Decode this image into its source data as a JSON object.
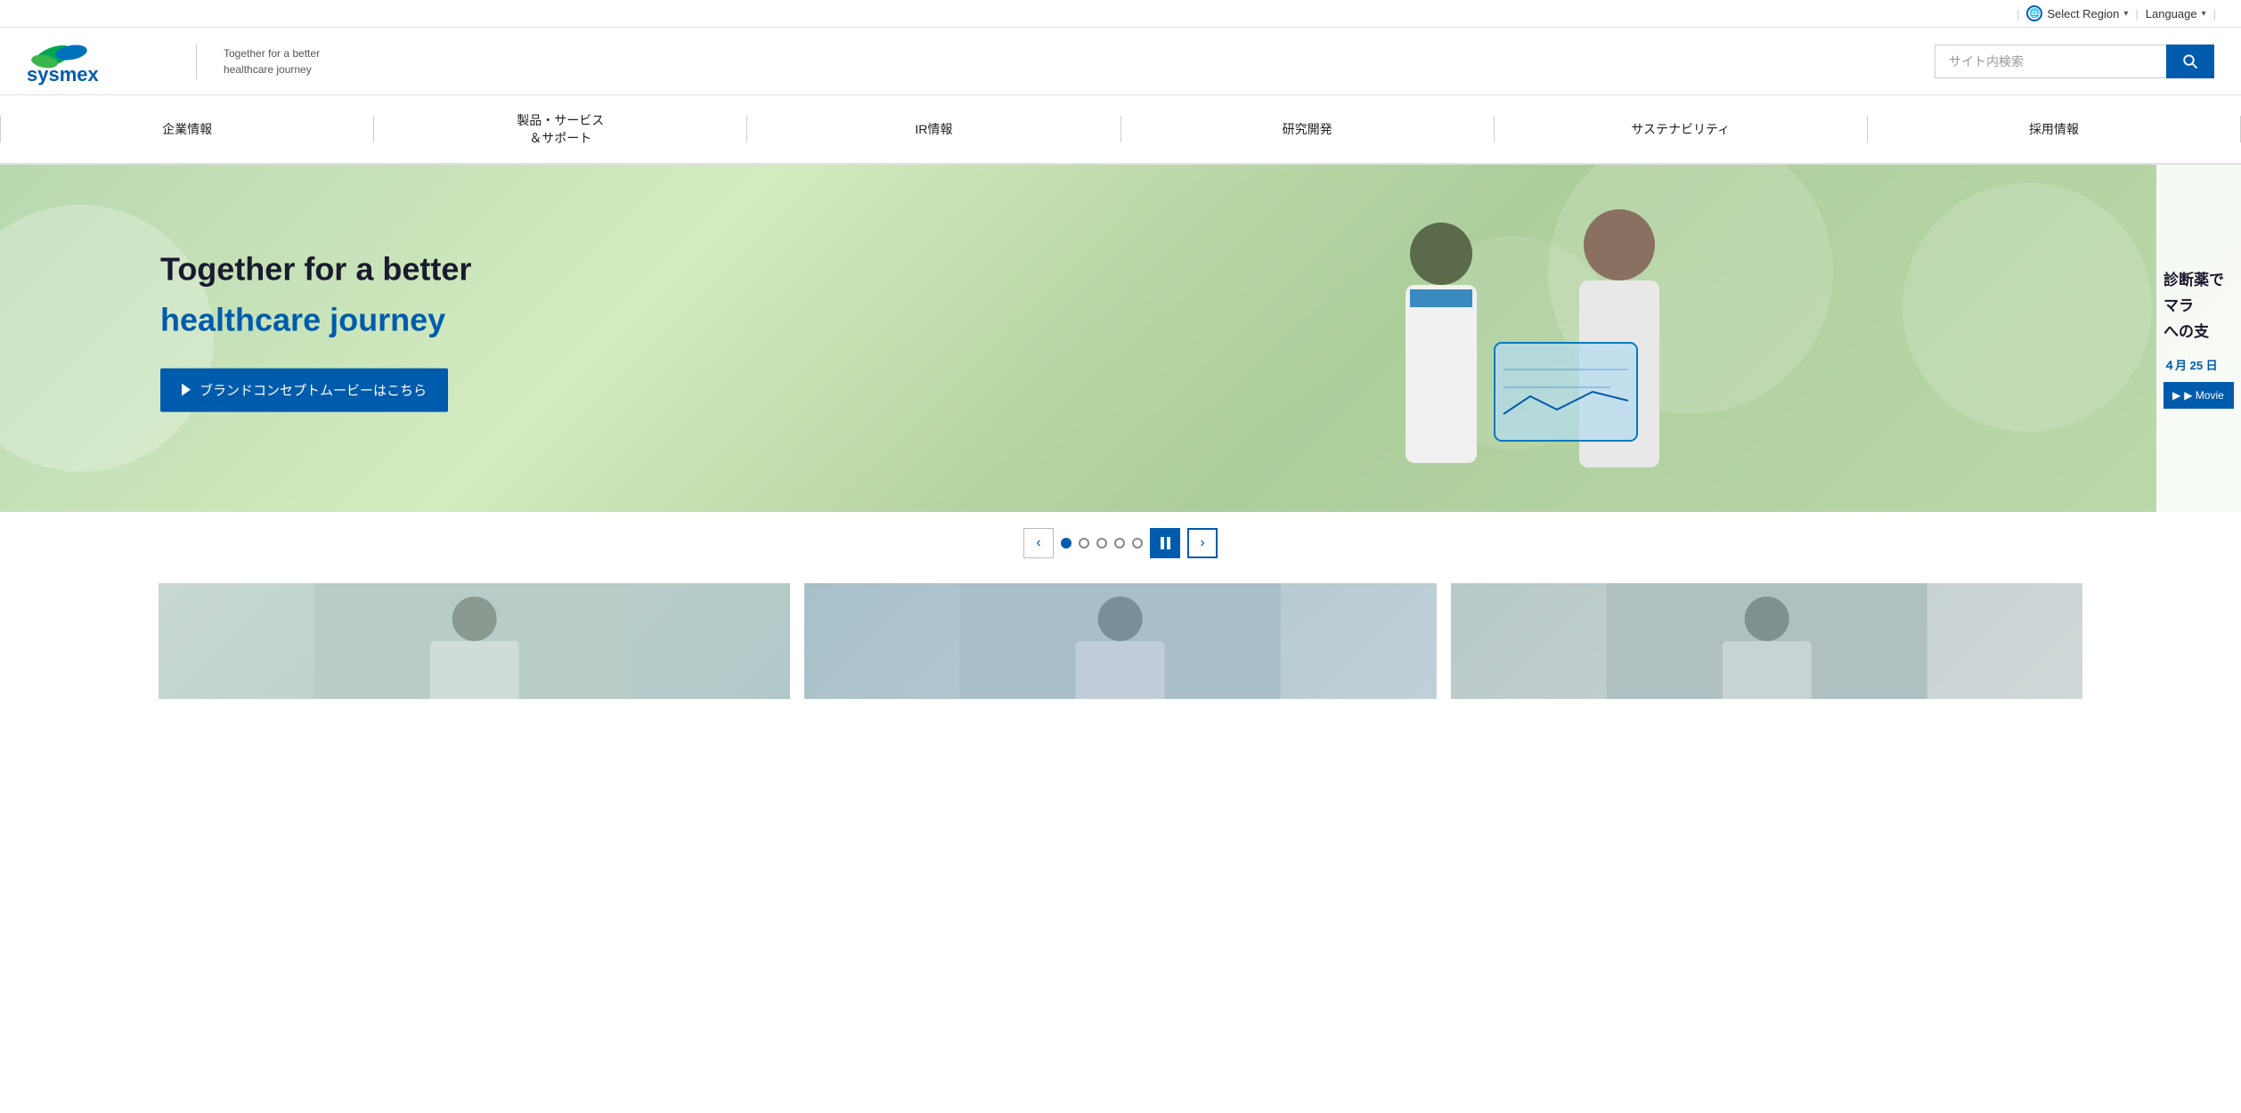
{
  "topbar": {
    "separator1": "|",
    "select_region_label": "Select Region",
    "separator2": "|",
    "language_label": "Language",
    "separator3": "|"
  },
  "header": {
    "logo_alt": "Sysmex",
    "tagline_line1": "Together for a better",
    "tagline_line2": "healthcare journey",
    "search_placeholder": "サイト内検索"
  },
  "nav": {
    "items": [
      {
        "label": "企業情報"
      },
      {
        "label": "製品・サービス\n＆サポート"
      },
      {
        "label": "IR情報"
      },
      {
        "label": "研究開発"
      },
      {
        "label": "サステナビリティ"
      },
      {
        "label": "採用情報"
      }
    ]
  },
  "hero": {
    "main_text": "Together for a better",
    "sub_text": "healthcare journey",
    "cta_button": "ブランドコンセプトムービーはこちら"
  },
  "side_panel": {
    "text_line1": "診断薬で",
    "text_line2": "マラ",
    "text_line3": "への支",
    "date": "４月 25 日",
    "movie_btn": "▶ Movie"
  },
  "slider": {
    "prev_label": "‹",
    "next_label": "›",
    "dots": [
      true,
      false,
      false,
      false,
      false
    ],
    "pause_label": "⏸"
  },
  "cards": [
    {
      "id": 1,
      "alt": "card image 1"
    },
    {
      "id": 2,
      "alt": "card image 2"
    },
    {
      "id": 3,
      "alt": "card image 3"
    }
  ]
}
